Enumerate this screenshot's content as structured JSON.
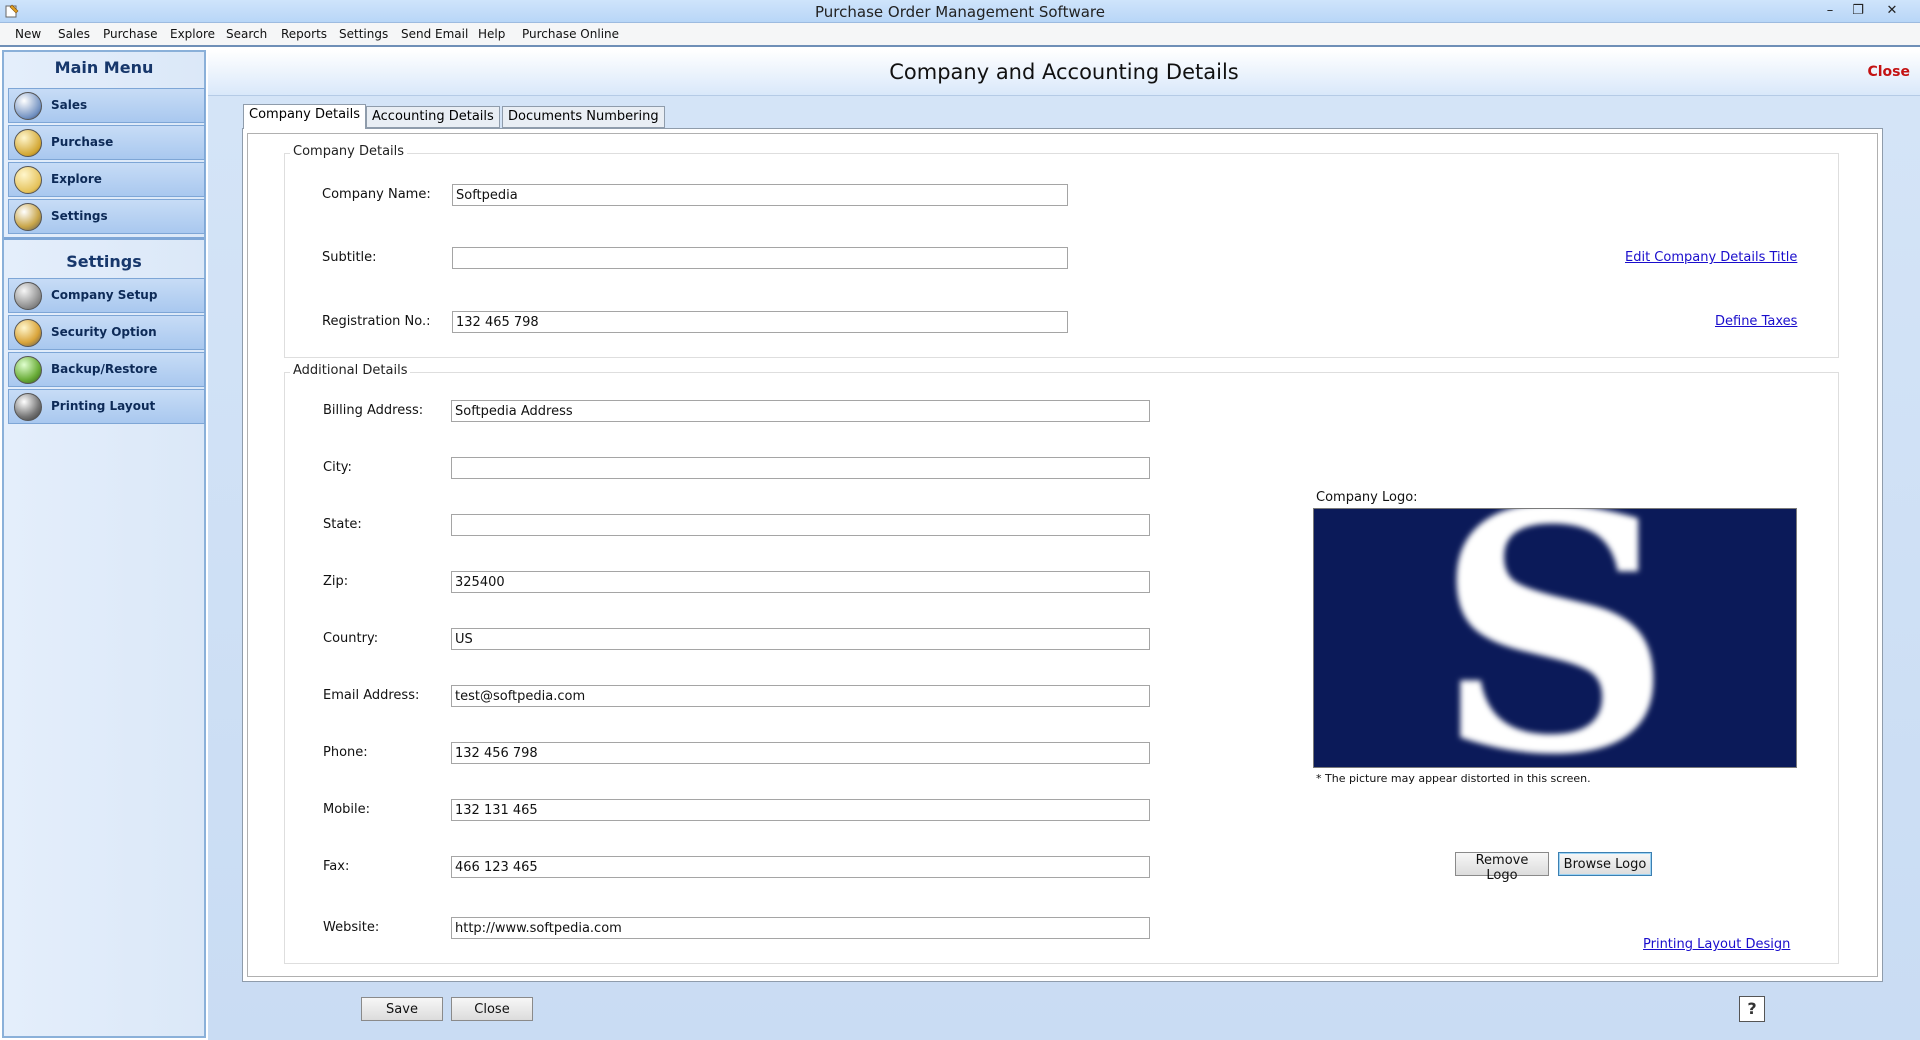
{
  "window": {
    "title": "Purchase Order Management Software"
  },
  "menu": [
    "New",
    "Sales",
    "Purchase",
    "Explore",
    "Search",
    "Reports",
    "Settings",
    "Send Email",
    "Help",
    "Purchase Online"
  ],
  "sidebar": {
    "main_title": "Main Menu",
    "main_items": [
      {
        "label": "Sales",
        "icon": "chart-icon"
      },
      {
        "label": "Purchase",
        "icon": "box-icon"
      },
      {
        "label": "Explore",
        "icon": "folder-icon"
      },
      {
        "label": "Settings",
        "icon": "gear-icon"
      }
    ],
    "settings_title": "Settings",
    "settings_items": [
      {
        "label": "Company Setup",
        "icon": "company-icon"
      },
      {
        "label": "Security Option",
        "icon": "lock-icon"
      },
      {
        "label": "Backup/Restore",
        "icon": "backup-icon"
      },
      {
        "label": "Printing Layout",
        "icon": "printer-icon"
      }
    ]
  },
  "header": {
    "title": "Company and Accounting Details",
    "close": "Close"
  },
  "tabs": [
    "Company Details",
    "Accounting Details",
    "Documents Numbering"
  ],
  "company": {
    "group_title": "Company Details",
    "name_label": "Company Name:",
    "name_value": "Softpedia",
    "subtitle_label": "Subtitle:",
    "subtitle_value": "",
    "reg_label": "Registration No.:",
    "reg_value": "132 465 798",
    "edit_title_link": "Edit Company Details Title",
    "define_taxes_link": "Define Taxes"
  },
  "additional": {
    "group_title": "Additional Details",
    "billing_label": "Billing Address:",
    "billing_value": "Softpedia Address",
    "city_label": "City:",
    "city_value": "",
    "state_label": "State:",
    "state_value": "",
    "zip_label": "Zip:",
    "zip_value": "325400",
    "country_label": "Country:",
    "country_value": "US",
    "email_label": "Email Address:",
    "email_value": "test@softpedia.com",
    "phone_label": "Phone:",
    "phone_value": "132 456 798",
    "mobile_label": "Mobile:",
    "mobile_value": "132 131 465",
    "fax_label": "Fax:",
    "fax_value": "466 123 465",
    "website_label": "Website:",
    "website_value": "http://www.softpedia.com",
    "logo_label": "Company Logo:",
    "logo_note": "* The picture may appear distorted in this screen.",
    "logo_letter": "S",
    "remove_logo": "Remove Logo",
    "browse_logo": "Browse Logo",
    "printing_layout_link": "Printing Layout Design"
  },
  "footer": {
    "save": "Save",
    "close": "Close",
    "help": "?"
  }
}
